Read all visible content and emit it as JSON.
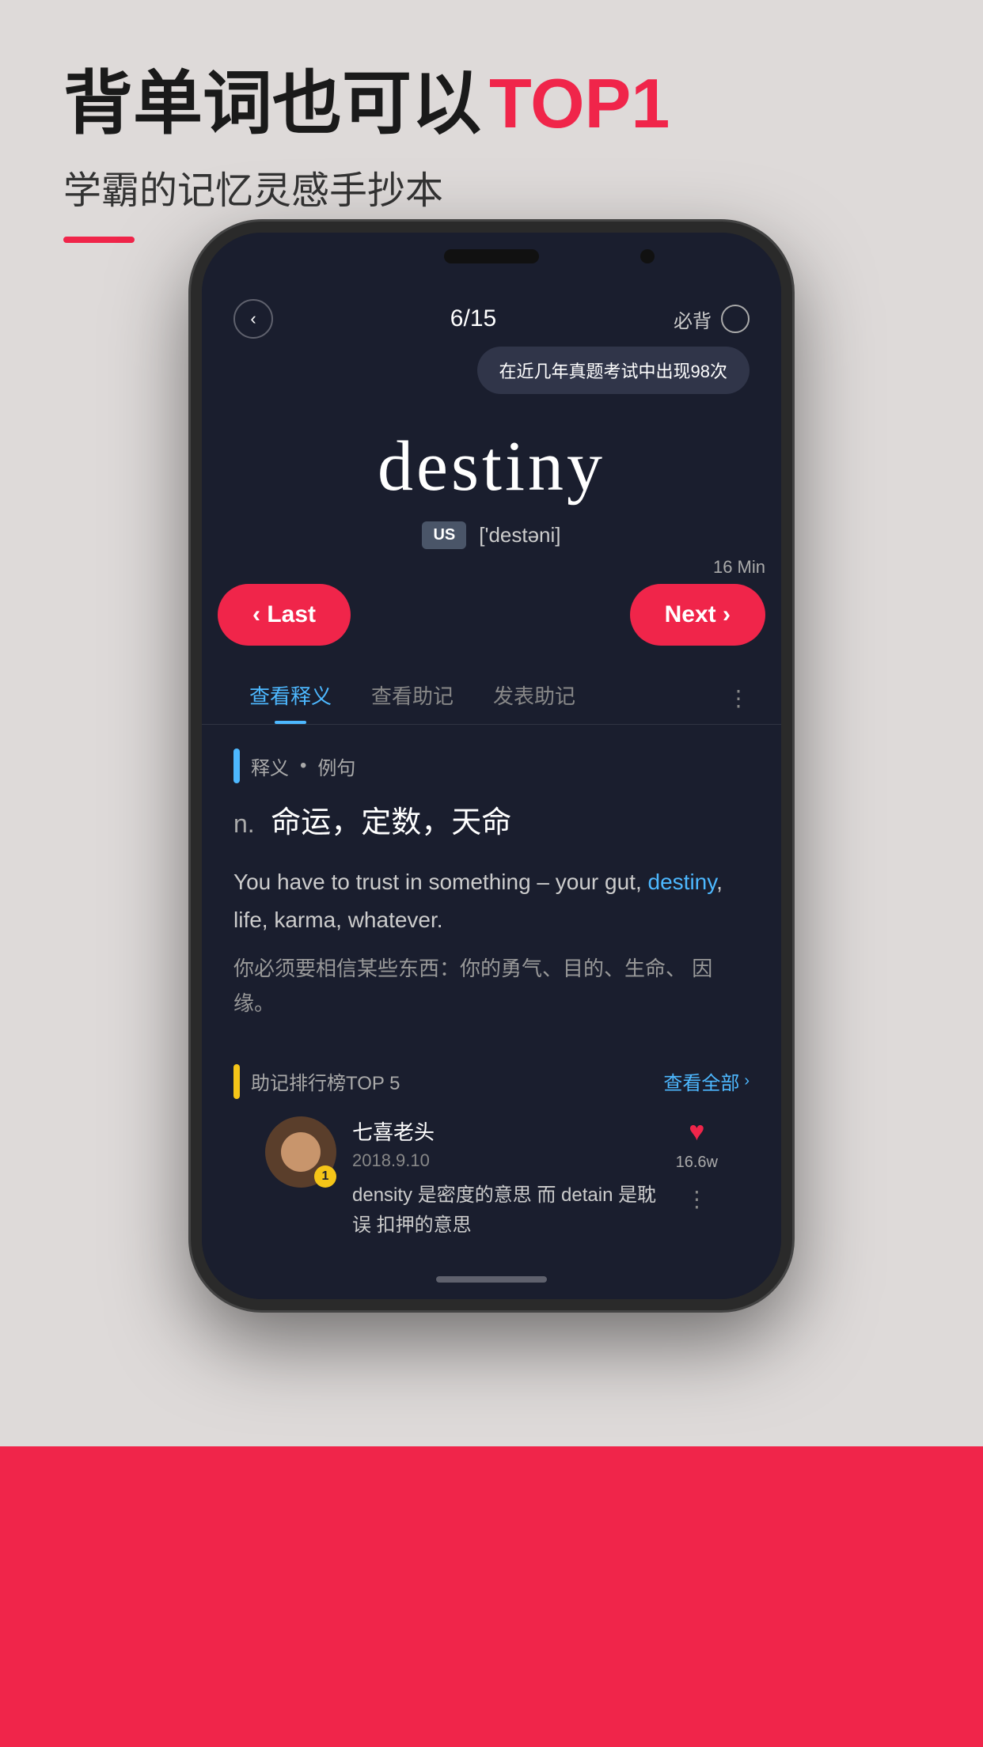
{
  "page": {
    "background_color": "#dedad9"
  },
  "header": {
    "title_part1": "背单词也可以",
    "title_highlight": "TOP1",
    "subtitle": "学霸的记忆灵感手抄本"
  },
  "phone": {
    "nav": {
      "back_label": "‹",
      "page_count": "6/15",
      "must_learn_label": "必背"
    },
    "tooltip": "在近几年真题考试中出现98次",
    "word": {
      "text": "destiny",
      "pronunciation_badge": "US",
      "pronunciation": "['destəni]"
    },
    "time_label": "16 Min",
    "btn_last": "‹ Last",
    "btn_next": "Next ›",
    "tabs": [
      {
        "label": "查看释义",
        "active": true
      },
      {
        "label": "查看助记",
        "active": false
      },
      {
        "label": "发表助记",
        "active": false
      }
    ],
    "definition": {
      "section_title": "释义",
      "section_dot": "•",
      "section_subtitle": "例句",
      "part_of_speech": "n.",
      "meanings": "命运，定数，天命",
      "example_en_before": "You have to trust in something –\nyour gut, ",
      "example_en_highlight": "destiny",
      "example_en_after": ", life, karma, whatever.",
      "example_zh": "你必须要相信某些东西：你的勇气、目的、生命、\n因缘。"
    },
    "mnemonic": {
      "section_title": "助记排行榜TOP 5",
      "view_all": "查看全部",
      "user": {
        "name": "七喜老头",
        "date": "2018.9.10",
        "badge_number": "1",
        "content": "density 是密度的意思  而 detain 是耽误\n扣押的意思",
        "likes": "16.6w"
      }
    }
  }
}
